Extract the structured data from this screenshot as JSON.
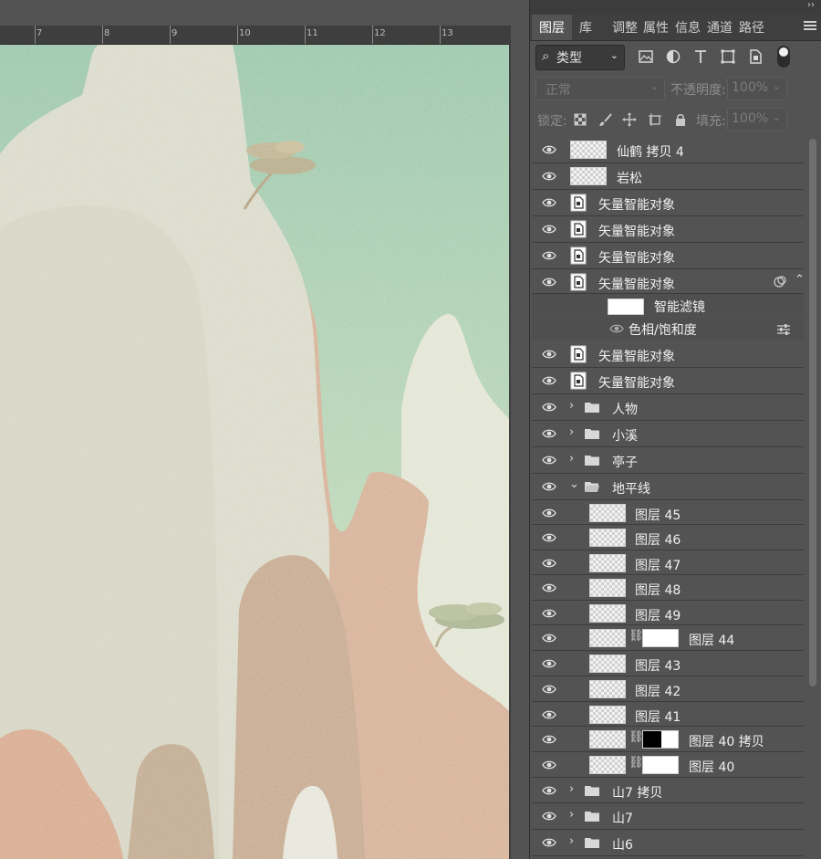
{
  "ruler": {
    "ticks": [
      "7",
      "8",
      "9",
      "10",
      "11",
      "12",
      "13"
    ]
  },
  "panel": {
    "collapse_glyph": "››",
    "tabs": [
      {
        "label": "图层",
        "active": true
      },
      {
        "label": "库",
        "active": false
      },
      {
        "label": "调整",
        "active": false
      },
      {
        "label": "属性",
        "active": false
      },
      {
        "label": "信息",
        "active": false
      },
      {
        "label": "通道",
        "active": false
      },
      {
        "label": "路径",
        "active": false
      }
    ],
    "menu_icon": "panel-menu-icon"
  },
  "filter": {
    "search_glyph": "⌕",
    "kind": "类型",
    "icons": [
      "image-filter-icon",
      "adjustment-filter-icon",
      "type-filter-icon",
      "shape-filter-icon",
      "smart-object-filter-icon"
    ]
  },
  "blend": {
    "mode": "正常",
    "opacity_label": "不透明度:",
    "opacity_value": "100%"
  },
  "lock": {
    "label": "锁定:",
    "icons": [
      "lock-transparent-icon",
      "lock-paint-icon",
      "lock-position-icon",
      "lock-artboard-icon",
      "lock-all-icon"
    ],
    "fill_label": "填充:",
    "fill_value": "100%"
  },
  "layers": [
    {
      "kind": "pixel",
      "name": "仙鹤 拷贝 4"
    },
    {
      "kind": "pixel",
      "name": "岩松"
    },
    {
      "kind": "smart",
      "name": "矢量智能对象"
    },
    {
      "kind": "smart",
      "name": "矢量智能对象"
    },
    {
      "kind": "smart",
      "name": "矢量智能对象"
    },
    {
      "kind": "smart",
      "name": "矢量智能对象",
      "expanded": true
    },
    {
      "kind": "smart-filter",
      "name": "智能滤镜"
    },
    {
      "kind": "filter-item",
      "name": "色相/饱和度"
    },
    {
      "kind": "smart",
      "name": "矢量智能对象"
    },
    {
      "kind": "smart",
      "name": "矢量智能对象"
    },
    {
      "kind": "group",
      "name": "人物",
      "open": false
    },
    {
      "kind": "group",
      "name": "小溪",
      "open": false
    },
    {
      "kind": "group",
      "name": "亭子",
      "open": false
    },
    {
      "kind": "group",
      "name": "地平线",
      "open": true
    },
    {
      "kind": "child",
      "name": "图层 45"
    },
    {
      "kind": "child",
      "name": "图层 46"
    },
    {
      "kind": "child",
      "name": "图层 47"
    },
    {
      "kind": "child",
      "name": "图层 48"
    },
    {
      "kind": "child",
      "name": "图层 49"
    },
    {
      "kind": "child-mask",
      "name": "图层 44"
    },
    {
      "kind": "child",
      "name": "图层 43"
    },
    {
      "kind": "child",
      "name": "图层 42"
    },
    {
      "kind": "child",
      "name": "图层 41"
    },
    {
      "kind": "child-mask",
      "name": "图层 40 拷贝"
    },
    {
      "kind": "child-mask",
      "name": "图层 40"
    },
    {
      "kind": "group",
      "name": "山7 拷贝",
      "open": false
    },
    {
      "kind": "group",
      "name": "山7",
      "open": false
    },
    {
      "kind": "group",
      "name": "山6",
      "open": false
    }
  ],
  "colors": {
    "panel_bg": "#535353",
    "sky_top": "#9ec9ae",
    "sky_bottom": "#d6e3c4",
    "mountain_warm": "#d6ad93",
    "mountain_light": "#dfe2d0"
  }
}
